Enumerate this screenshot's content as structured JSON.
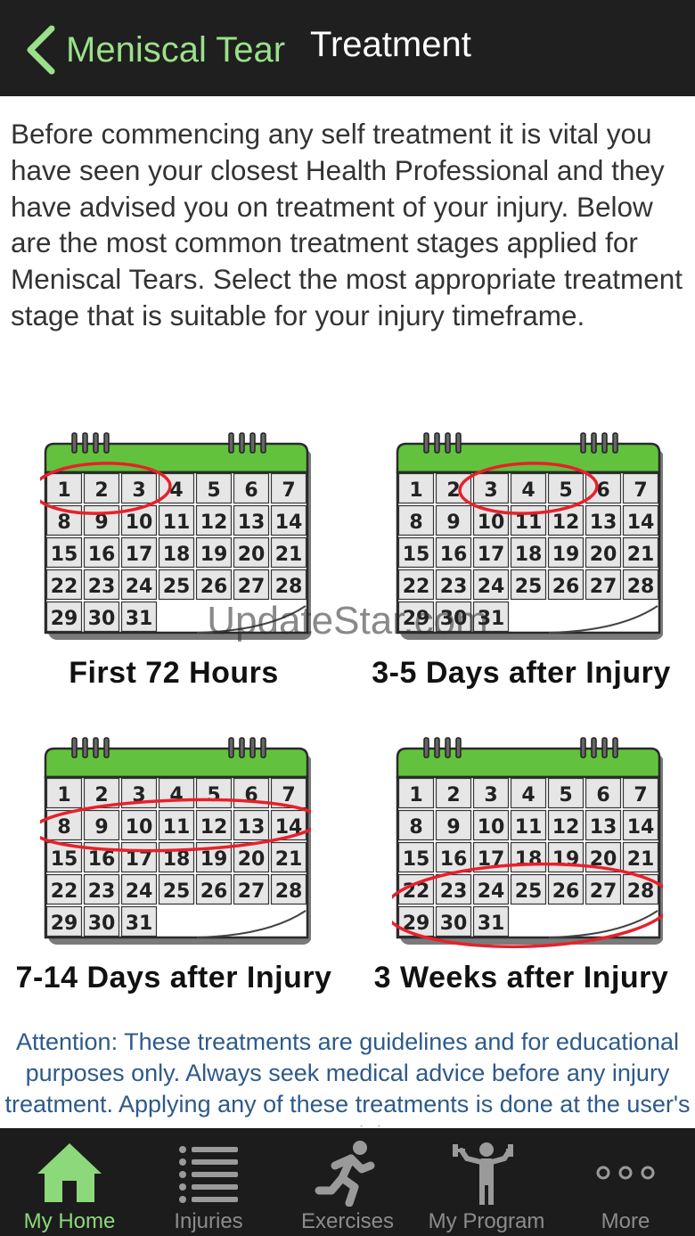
{
  "nav": {
    "back_label": "Meniscal Tear",
    "title": "Treatment"
  },
  "intro": "Before commencing any self treatment it is vital you have seen your closest Health Professional and they have advised you on treatment of your injury. Below are the most common treatment stages applied for Meniscal Tears. Select the most appropriate treatment stage that is suitable for your injury timeframe.",
  "stages": [
    {
      "label": "First 72 Hours",
      "highlight": [
        1,
        2,
        3
      ]
    },
    {
      "label": "3-5 Days after Injury",
      "highlight": [
        3,
        4,
        5
      ]
    },
    {
      "label": "7-14 Days after Injury",
      "highlight": [
        8,
        9,
        10,
        11,
        12,
        13,
        14
      ]
    },
    {
      "label": "3 Weeks after Injury",
      "highlight": [
        22,
        23,
        24,
        25,
        26,
        27,
        28,
        29,
        30,
        31
      ]
    }
  ],
  "calendar_days": [
    1,
    2,
    3,
    4,
    5,
    6,
    7,
    8,
    9,
    10,
    11,
    12,
    13,
    14,
    15,
    16,
    17,
    18,
    19,
    20,
    21,
    22,
    23,
    24,
    25,
    26,
    27,
    28,
    29,
    30,
    31
  ],
  "watermark": "UpdateStar.com",
  "attention": "Attention: These treatments are guidelines and for educational purposes only. Always seek medical advice before any injury treatment. Applying any of these treatments is done at the user's own risk.",
  "tabs": [
    {
      "label": "My Home",
      "icon": "home-icon",
      "active": true
    },
    {
      "label": "Injuries",
      "icon": "list-icon",
      "active": false
    },
    {
      "label": "Exercises",
      "icon": "running-icon",
      "active": false
    },
    {
      "label": "My Program",
      "icon": "dumbbell-icon",
      "active": false
    },
    {
      "label": "More",
      "icon": "more-icon",
      "active": false
    }
  ],
  "colors": {
    "accent_green": "#8ed87c",
    "calendar_green": "#62c23d",
    "circle_red": "#e8202a",
    "attention_blue": "#2d5a8a"
  }
}
